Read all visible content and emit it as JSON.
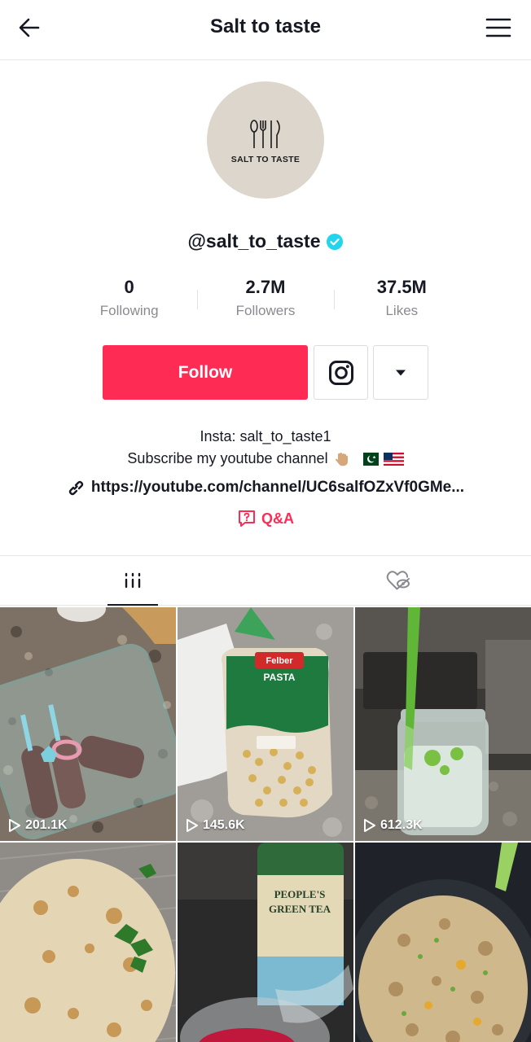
{
  "header": {
    "title": "Salt to taste",
    "back_icon": "arrow-left-icon",
    "menu_icon": "hamburger-menu-icon"
  },
  "profile": {
    "avatar_text": "SALT TO TASTE",
    "username": "@salt_to_taste",
    "verified": true
  },
  "stats": [
    {
      "value": "0",
      "label": "Following"
    },
    {
      "value": "2.7M",
      "label": "Followers"
    },
    {
      "value": "37.5M",
      "label": "Likes"
    }
  ],
  "actions": {
    "follow_label": "Follow",
    "instagram_icon": "instagram-icon",
    "more_icon": "caret-down-icon"
  },
  "bio": {
    "line1": "Insta: salt_to_taste1",
    "line2": "Subscribe my youtube channel",
    "link": "https://youtube.com/channel/UC6salfOZxVf0GMe...",
    "qa_label": "Q&A"
  },
  "tabs": [
    {
      "icon": "videos-grid-icon",
      "active": true
    },
    {
      "icon": "liked-hidden-icon",
      "active": false
    }
  ],
  "videos": [
    {
      "views": "201.1K"
    },
    {
      "views": "145.6K"
    },
    {
      "views": "612.3K"
    },
    {
      "views": ""
    },
    {
      "views": ""
    },
    {
      "views": ""
    }
  ],
  "colors": {
    "accent": "#fe2c55",
    "verified": "#20d5ec",
    "text": "#161823",
    "muted": "#8a8b91"
  }
}
